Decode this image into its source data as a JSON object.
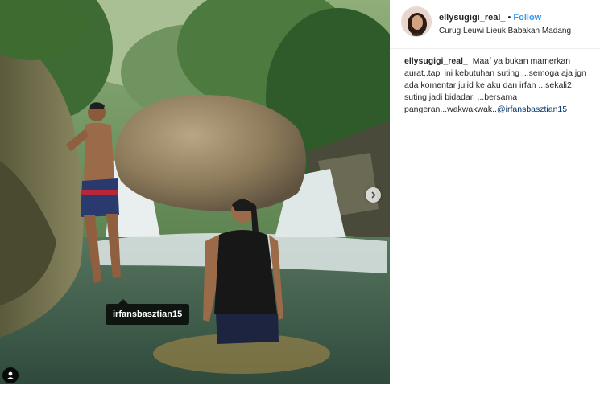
{
  "post": {
    "username": "ellysugigi_real_",
    "separator": "•",
    "follow_label": "Follow",
    "location": "Curug Leuwi Lieuk Babakan Madang",
    "caption_user": "ellysugigi_real_",
    "caption_text": "Maaf ya bukan mamerkan aurat..tapi ini kebutuhan suting ...semoga aja jgn ada komentar julid ke aku dan irfan ...sekali2 suting jadi bidadari ...bersama pangeran...wakwakwak..",
    "caption_mention": "@irfansbasztian15"
  },
  "photo": {
    "tag_label": "irfansbasztian15",
    "next_icon": "chevron-right-icon",
    "user_icon": "user-tag-icon"
  },
  "colors": {
    "follow": "#3897f0",
    "mention": "#003569",
    "text": "#262626"
  }
}
